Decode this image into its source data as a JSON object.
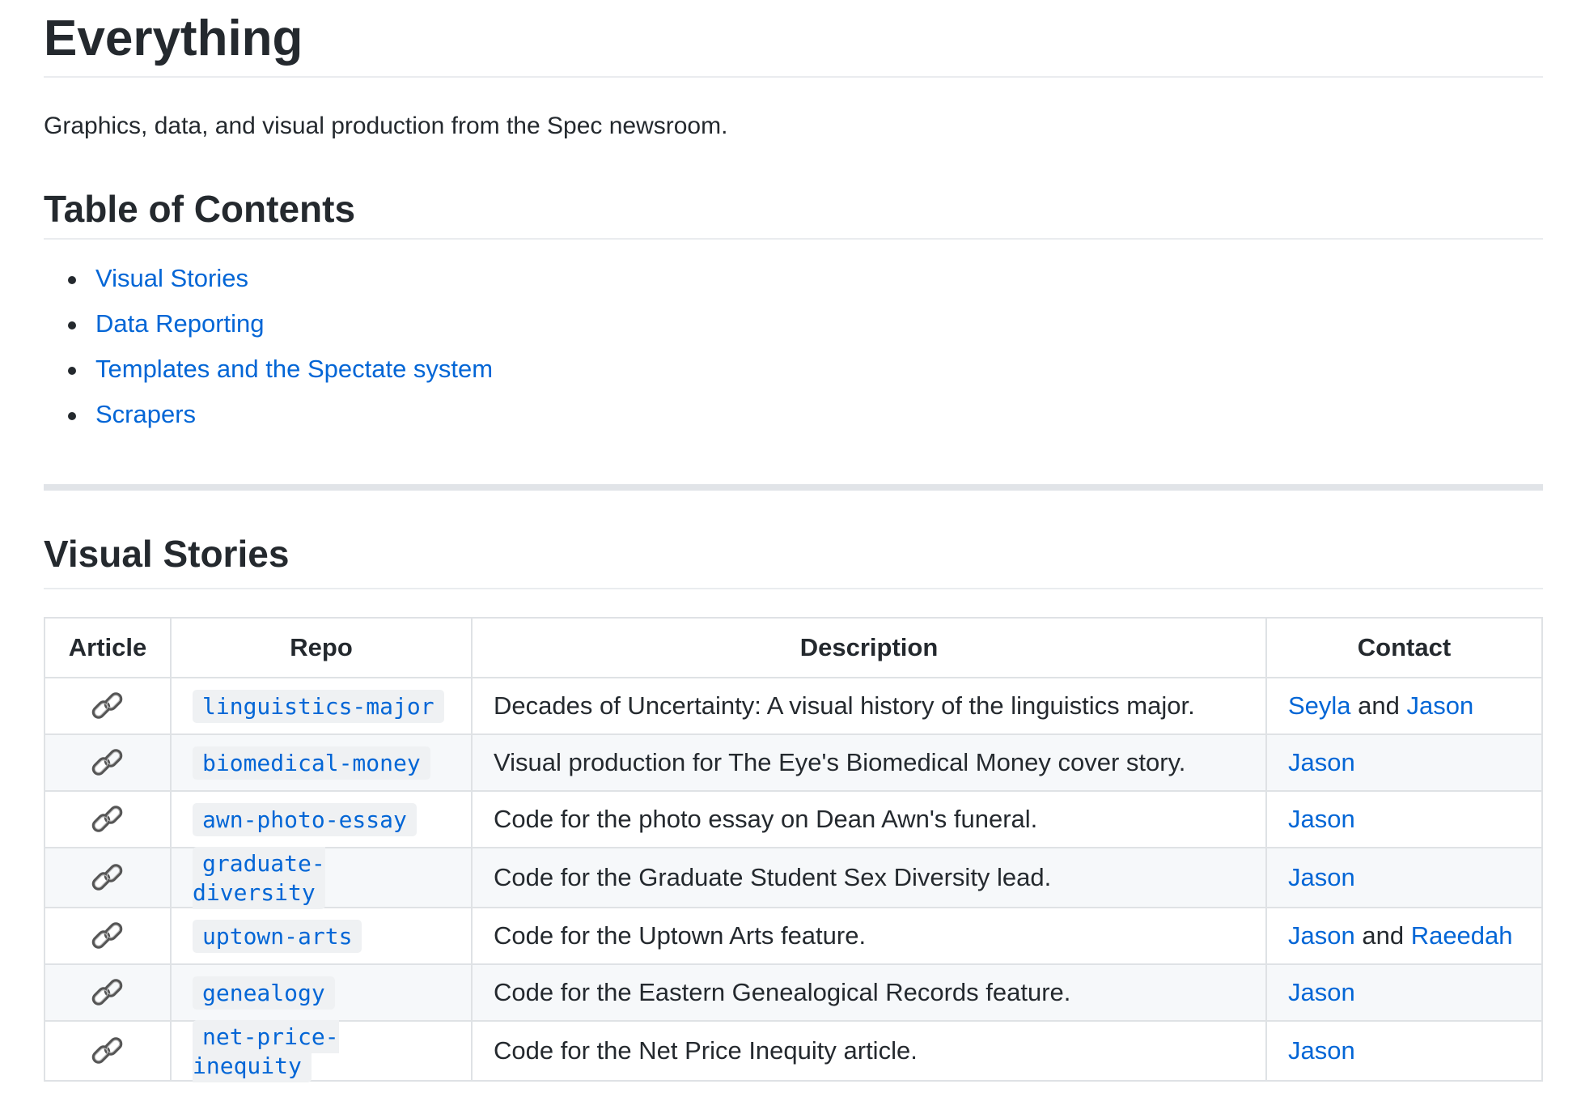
{
  "page": {
    "title": "Everything",
    "intro": "Graphics, data, and visual production from the Spec newsroom."
  },
  "toc": {
    "heading": "Table of Contents",
    "items": [
      {
        "label": "Visual Stories"
      },
      {
        "label": "Data Reporting"
      },
      {
        "label": "Templates and the Spectate system"
      },
      {
        "label": "Scrapers"
      }
    ]
  },
  "visual_stories": {
    "heading": "Visual Stories",
    "table": {
      "columns": [
        "Article",
        "Repo",
        "Description",
        "Contact"
      ],
      "rows": [
        {
          "icon": "link-icon",
          "repo": "linguistics-major",
          "description": "Decades of Uncertainty: A visual history of the linguistics major.",
          "contact1": "Seyla",
          "joiner": " and ",
          "contact2": "Jason"
        },
        {
          "icon": "link-icon",
          "repo": "biomedical-money",
          "description": "Visual production for The Eye's Biomedical Money cover story.",
          "contact1": "Jason",
          "joiner": "",
          "contact2": ""
        },
        {
          "icon": "link-icon",
          "repo": "awn-photo-essay",
          "description": "Code for the photo essay on Dean Awn's funeral.",
          "contact1": "Jason",
          "joiner": "",
          "contact2": ""
        },
        {
          "icon": "link-icon",
          "repo": "graduate-diversity",
          "description": "Code for the Graduate Student Sex Diversity lead.",
          "contact1": "Jason",
          "joiner": "",
          "contact2": ""
        },
        {
          "icon": "link-icon",
          "repo": "uptown-arts",
          "description": "Code for the Uptown Arts feature.",
          "contact1": "Jason",
          "joiner": " and ",
          "contact2": "Raeedah"
        },
        {
          "icon": "link-icon",
          "repo": "genealogy",
          "description": "Code for the Eastern Genealogical Records feature.",
          "contact1": "Jason",
          "joiner": "",
          "contact2": ""
        },
        {
          "icon": "link-icon",
          "repo": "net-price-inequity",
          "description": "Code for the Net Price Inequity article.",
          "contact1": "Jason",
          "joiner": "",
          "contact2": ""
        }
      ]
    }
  },
  "colors": {
    "link": "#0366d6",
    "text": "#24292e",
    "border": "#dfe2e5",
    "code_bg": "#eff1f3"
  }
}
